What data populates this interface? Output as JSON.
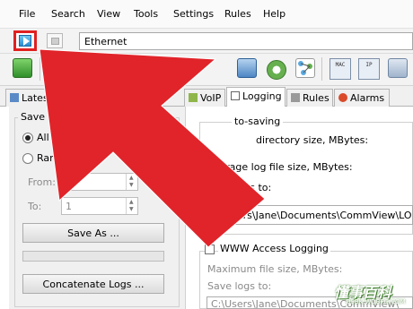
{
  "menubar": {
    "items": [
      "File",
      "Search",
      "View",
      "Tools",
      "Settings",
      "Rules",
      "Help"
    ]
  },
  "toolbar": {
    "adapter_value": "Ethernet",
    "mac_label": "MAC",
    "ip_label": "IP"
  },
  "tabs": [
    {
      "label": "Latest IP Co"
    },
    {
      "label": "VoIP"
    },
    {
      "label": "Logging"
    },
    {
      "label": "Rules"
    },
    {
      "label": "Alarms"
    }
  ],
  "save_manage": {
    "title": "Save and Manage",
    "all_packets_label": "All packets in buffe",
    "range_label": "Range",
    "from_label": "From:",
    "from_value": "1",
    "to_label": "To:",
    "to_value": "1",
    "save_as_label": "Save As ...",
    "concatenate_label": "Concatenate Logs ..."
  },
  "autosaving": {
    "title": "to-saving",
    "max_dir_label": "directory size, MBytes:",
    "avg_log_label": "Average log file size, MBytes:",
    "save_logs_to_label": "Save logs to:",
    "save_logs_path": "C:\\Users\\Jane\\Documents\\CommView\\LOGS"
  },
  "www_logging": {
    "title": "WWW Access Logging",
    "max_file_label": "Maximum file size, MBytes:",
    "save_logs_to_label": "Save logs to:",
    "save_logs_path": "C:\\Users\\Jane\\Documents\\CommView\\"
  },
  "watermark": {
    "main": "懂事百科",
    "sub": "DSBK.WDBFG.COM"
  },
  "colors": {
    "annotation_red": "#e0242a",
    "highlight_border": "#e02020"
  }
}
